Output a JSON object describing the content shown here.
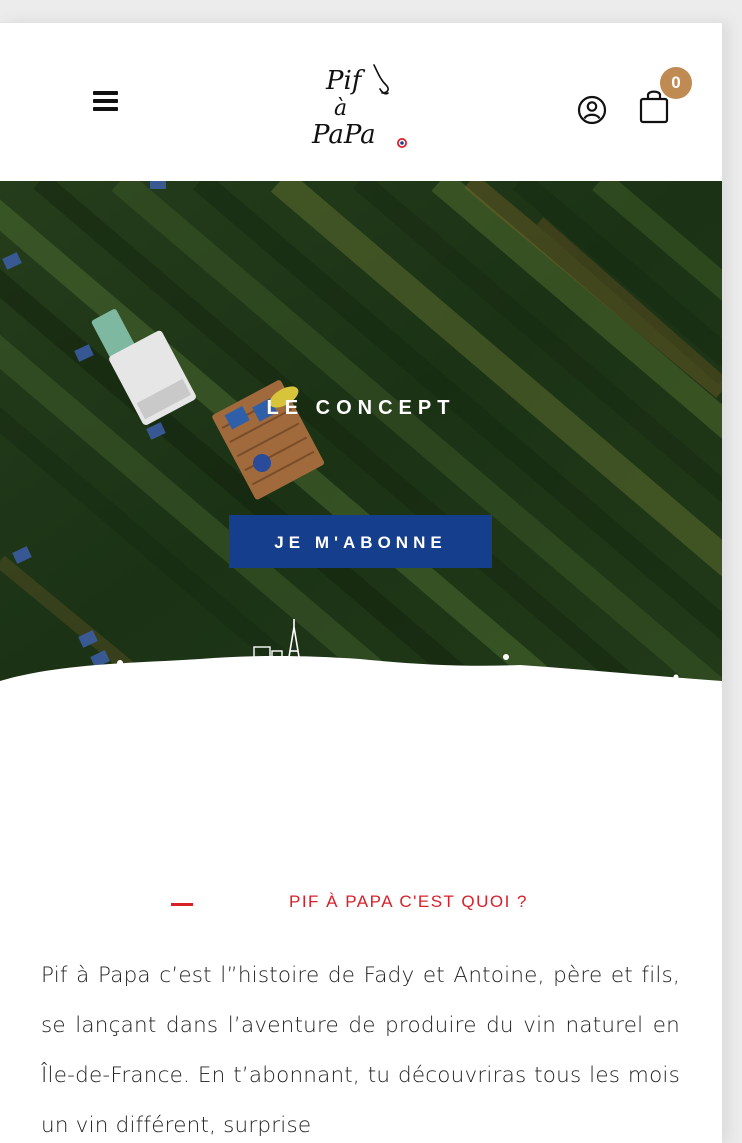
{
  "header": {
    "logo_text_line1": "Pif",
    "logo_text_line2": "à",
    "logo_text_line3": "PaPa",
    "cart_count": "0",
    "menu_icon": "hamburger-icon",
    "account_icon": "user-circle-icon",
    "cart_icon": "shopping-bag-icon"
  },
  "hero": {
    "title": "LE CONCEPT",
    "cta_label": "JE M'ABONNE"
  },
  "section": {
    "title": "PIF À PAPA C'EST QUOI ?",
    "paragraph": "Pif à Papa c’est l”histoire de Fady et Antoine, père et fils, se lançant dans l’aventure de produire du vin naturel en Île-de-France. En t’abonnant, tu découvriras tous les mois un vin différent, surprise"
  },
  "colors": {
    "accent_red": "#d8202b",
    "cta_blue": "#153e8c",
    "badge_gold": "#c08a53"
  }
}
